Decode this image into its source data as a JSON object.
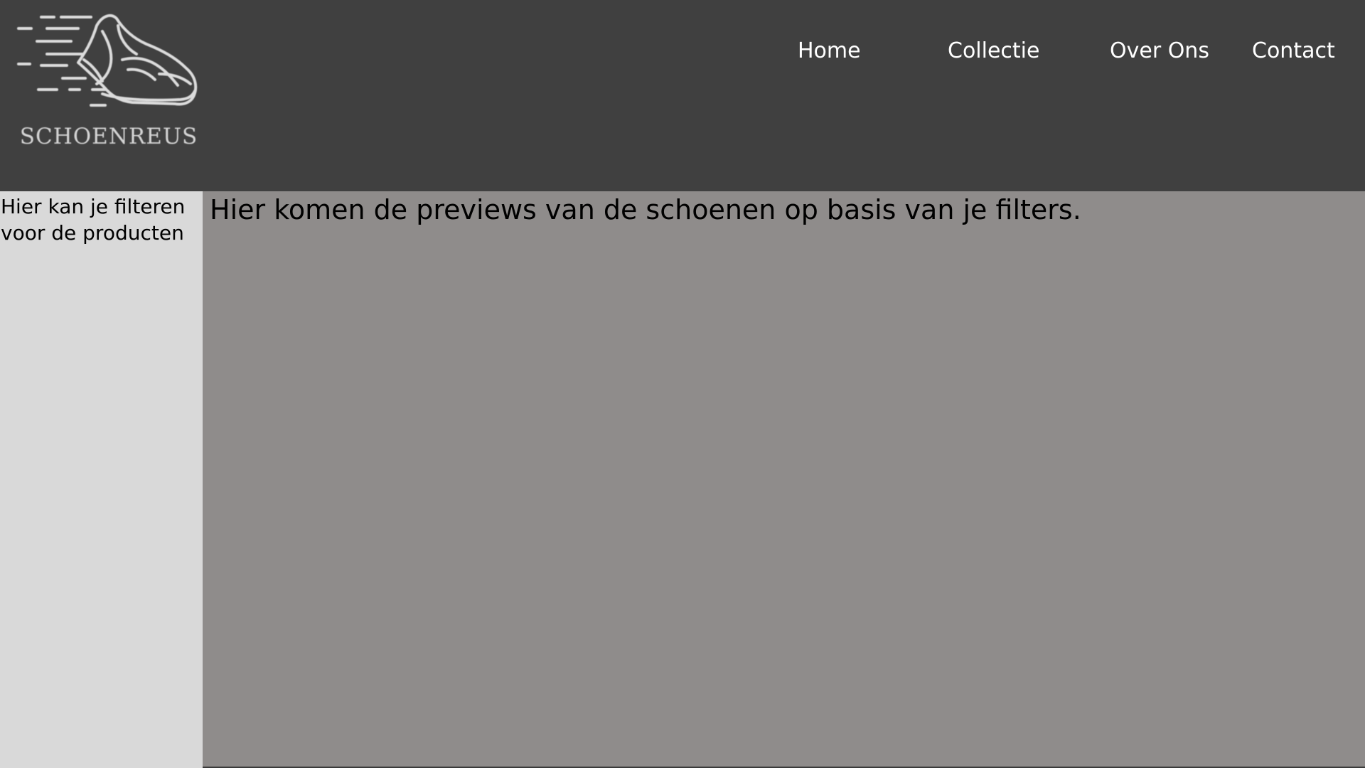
{
  "header": {
    "logo_text": "SCHOENREUS",
    "nav": {
      "home": "Home",
      "collectie": "Collectie",
      "over_ons": "Over Ons",
      "contact": "Contact"
    }
  },
  "sidebar": {
    "text": "Hier kan je filteren voor de producten"
  },
  "main": {
    "text": "Hier komen de previews van de schoenen op basis van je filters."
  },
  "colors": {
    "header_bg": "#404040",
    "sidebar_bg": "#d9d9d9",
    "content_bg": "#8f8c8b",
    "nav_text": "#ffffff"
  },
  "icons": {
    "logo": "running-shoe-icon"
  }
}
